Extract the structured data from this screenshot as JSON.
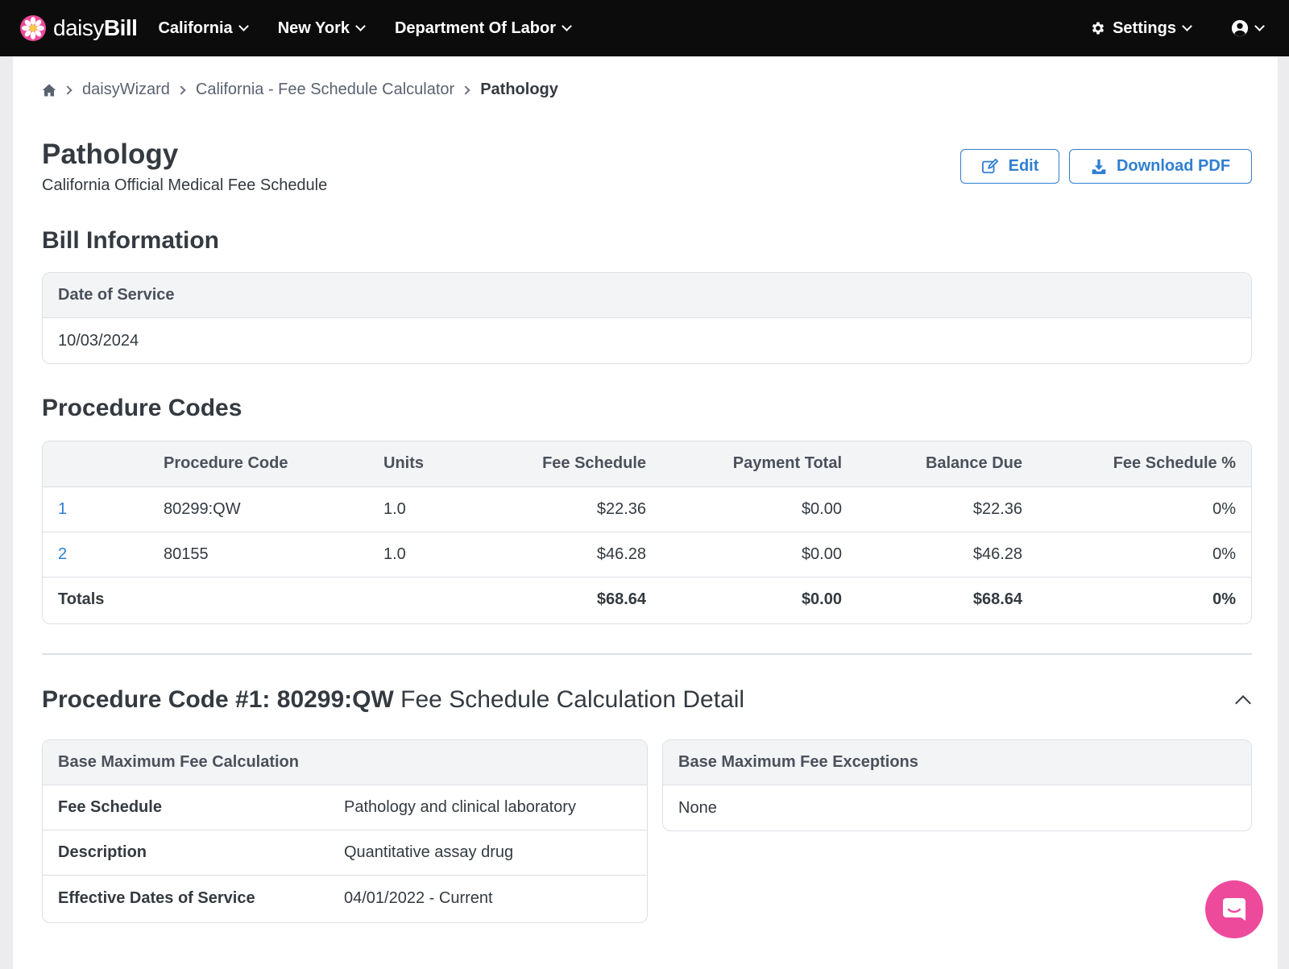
{
  "navbar": {
    "brand_light": "daisy",
    "brand_bold": "Bill",
    "items": [
      {
        "label": "California"
      },
      {
        "label": "New York"
      },
      {
        "label": "Department Of Labor"
      }
    ],
    "settings_label": "Settings"
  },
  "breadcrumb": {
    "items": [
      "daisyWizard",
      "California - Fee Schedule Calculator"
    ],
    "current": "Pathology"
  },
  "header": {
    "title": "Pathology",
    "subtitle": "California Official Medical Fee Schedule",
    "edit_label": "Edit",
    "pdf_label": "Download PDF"
  },
  "bill_info": {
    "title": "Bill Information",
    "field_label": "Date of Service",
    "field_value": "10/03/2024"
  },
  "procedure_codes": {
    "title": "Procedure Codes",
    "columns": [
      "",
      "Procedure Code",
      "Units",
      "Fee Schedule",
      "Payment Total",
      "Balance Due",
      "Fee Schedule %"
    ],
    "rows": [
      {
        "num": "1",
        "code": "80299:QW",
        "units": "1.0",
        "fee": "$22.36",
        "payment": "$0.00",
        "balance": "$22.36",
        "pct": "0%"
      },
      {
        "num": "2",
        "code": "80155",
        "units": "1.0",
        "fee": "$46.28",
        "payment": "$0.00",
        "balance": "$46.28",
        "pct": "0%"
      }
    ],
    "totals": {
      "label": "Totals",
      "fee": "$68.64",
      "payment": "$0.00",
      "balance": "$68.64",
      "pct": "0%"
    }
  },
  "detail": {
    "title_bold": "Procedure Code #1: 80299:QW",
    "title_rest": " Fee Schedule Calculation Detail",
    "base_calc": {
      "title": "Base Maximum Fee Calculation",
      "rows": [
        {
          "label": "Fee Schedule",
          "value": "Pathology and clinical laboratory"
        },
        {
          "label": "Description",
          "value": "Quantitative assay drug"
        },
        {
          "label": "Effective Dates of Service",
          "value": "04/01/2022 - Current"
        }
      ]
    },
    "exceptions": {
      "title": "Base Maximum Fee Exceptions",
      "value": "None"
    }
  },
  "colors": {
    "navbar_bg": "#0c0c0c",
    "accent_blue": "#2f7fd1",
    "chat_pink": "#ee4a9c",
    "daisy_pink": "#ee4a9c",
    "daisy_center": "#f7c948"
  }
}
